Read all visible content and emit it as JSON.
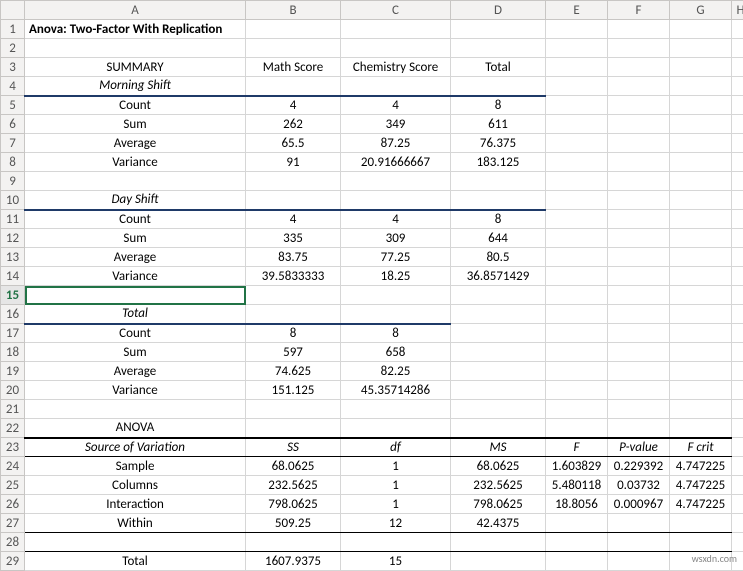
{
  "columns": [
    "",
    "A",
    "B",
    "C",
    "D",
    "E",
    "F",
    "G",
    "H"
  ],
  "rows": [
    "1",
    "2",
    "3",
    "4",
    "5",
    "6",
    "7",
    "8",
    "9",
    "10",
    "11",
    "12",
    "13",
    "14",
    "15",
    "16",
    "17",
    "18",
    "19",
    "20",
    "21",
    "22",
    "23",
    "24",
    "25",
    "26",
    "27",
    "28",
    "29"
  ],
  "selectedRow": "15",
  "title": "Anova: Two-Factor With Replication",
  "summary": {
    "label": "SUMMARY",
    "math": "Math Score",
    "chem": "Chemistry Score",
    "total": "Total"
  },
  "sections": {
    "morning": {
      "title": "Morning Shift",
      "rows": [
        {
          "label": "Count",
          "b": "4",
          "c": "4",
          "d": "8"
        },
        {
          "label": "Sum",
          "b": "262",
          "c": "349",
          "d": "611"
        },
        {
          "label": "Average",
          "b": "65.5",
          "c": "87.25",
          "d": "76.375"
        },
        {
          "label": "Variance",
          "b": "91",
          "c": "20.91666667",
          "d": "183.125"
        }
      ]
    },
    "day": {
      "title": "Day Shift",
      "rows": [
        {
          "label": "Count",
          "b": "4",
          "c": "4",
          "d": "8"
        },
        {
          "label": "Sum",
          "b": "335",
          "c": "309",
          "d": "644"
        },
        {
          "label": "Average",
          "b": "83.75",
          "c": "77.25",
          "d": "80.5"
        },
        {
          "label": "Variance",
          "b": "39.5833333",
          "c": "18.25",
          "d": "36.8571429"
        }
      ]
    },
    "totalsec": {
      "title": "Total",
      "rows": [
        {
          "label": "Count",
          "b": "8",
          "c": "8",
          "d": ""
        },
        {
          "label": "Sum",
          "b": "597",
          "c": "658",
          "d": ""
        },
        {
          "label": "Average",
          "b": "74.625",
          "c": "82.25",
          "d": ""
        },
        {
          "label": "Variance",
          "b": "151.125",
          "c": "45.35714286",
          "d": ""
        }
      ]
    }
  },
  "anova": {
    "title": "ANOVA",
    "headers": {
      "a": "Source of Variation",
      "b": "SS",
      "c": "df",
      "d": "MS",
      "e": "F",
      "f": "P-value",
      "g": "F crit"
    },
    "rows": [
      {
        "a": "Sample",
        "b": "68.0625",
        "c": "1",
        "d": "68.0625",
        "e": "1.603829",
        "f": "0.229392",
        "g": "4.747225"
      },
      {
        "a": "Columns",
        "b": "232.5625",
        "c": "1",
        "d": "232.5625",
        "e": "5.480118",
        "f": "0.03732",
        "g": "4.747225"
      },
      {
        "a": "Interaction",
        "b": "798.0625",
        "c": "1",
        "d": "798.0625",
        "e": "18.8056",
        "f": "0.000967",
        "g": "4.747225"
      },
      {
        "a": "Within",
        "b": "509.25",
        "c": "12",
        "d": "42.4375",
        "e": "",
        "f": "",
        "g": ""
      }
    ],
    "total": {
      "a": "Total",
      "b": "1607.9375",
      "c": "15"
    }
  },
  "watermark": "wsxdn.com",
  "colwidths": {
    "rownum": 24,
    "A": 221,
    "B": 95,
    "C": 110,
    "D": 95,
    "E": 62,
    "F": 62,
    "G": 62,
    "H": 18
  }
}
